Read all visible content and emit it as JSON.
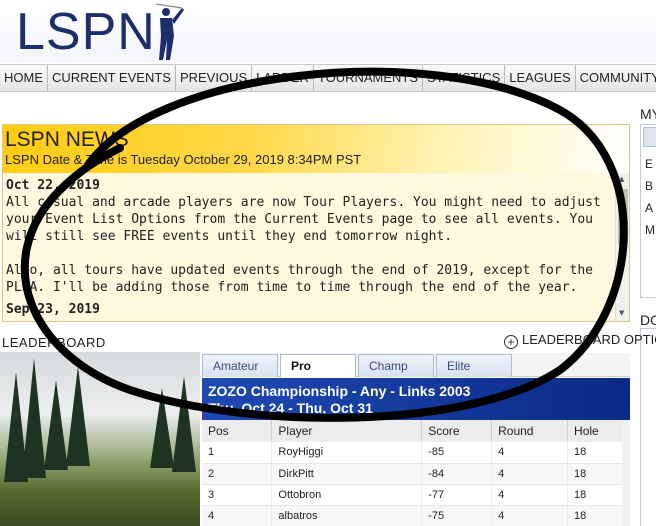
{
  "brand": {
    "logo_text": "LSPN",
    "logo_icon": "golfer-silhouette-icon"
  },
  "nav": {
    "items": [
      "HOME",
      "CURRENT EVENTS",
      "PREVIOUS",
      "LADDER",
      "TOURNAMENTS",
      "STATISTICS",
      "LEAGUES",
      "COMMUNITY"
    ]
  },
  "right_column": {
    "title": "MY",
    "rows": [
      "E",
      "B",
      "A",
      "M"
    ],
    "title2": "DO"
  },
  "news": {
    "title": "LSPN NEWS",
    "datetime": "LSPN Date & Time is Tuesday October 29, 2019 8:34PM PST",
    "entries": [
      {
        "date": "Oct 22, 2019",
        "paragraphs": [
          "All casual and arcade players are now Tour Players. You might need to adjust your Event List Options from the Current Events page to see all events. You will still see FREE events until they end tomorrow night.",
          "Also, all tours have updated events through the end of 2019, except for the PLSA. I'll be adding those from time to time through the end of the year."
        ]
      },
      {
        "date": "Sep 23, 2019",
        "paragraphs": []
      }
    ]
  },
  "leaderboard": {
    "title": "LEADERBOARD",
    "options_label": "LEADERBOARD OPTIONS",
    "tabs": [
      "Amateur",
      "Pro",
      "Champ",
      "Elite"
    ],
    "active_tab": "Pro",
    "event_name": "ZOZO Championship - Any - Links 2003",
    "event_dates": "Thu, Oct 24 - Thu, Oct 31",
    "columns": [
      "Pos",
      "Player",
      "Score",
      "Round",
      "Hole"
    ],
    "rows": [
      [
        "1",
        "RoyHiggi",
        "-85",
        "4",
        "18"
      ],
      [
        "2",
        "DirkPitt",
        "-84",
        "4",
        "18"
      ],
      [
        "3",
        "Ottobron",
        "-77",
        "4",
        "18"
      ],
      [
        "4",
        "albatros",
        "-75",
        "4",
        "18"
      ]
    ]
  },
  "annotation": {
    "shape": "hand-drawn-ellipse",
    "color": "#000000"
  }
}
